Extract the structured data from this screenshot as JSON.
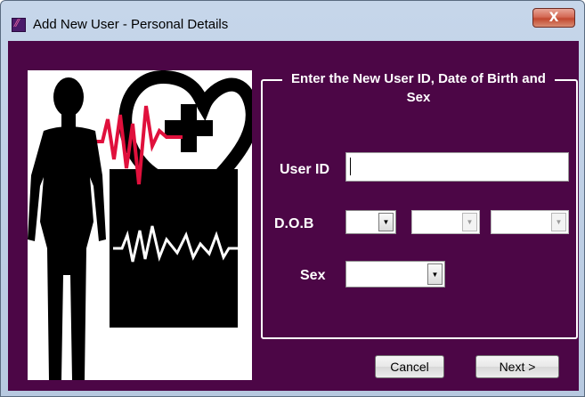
{
  "window": {
    "title": "Add New User - Personal Details",
    "close_label": "X"
  },
  "form": {
    "group_title": "Enter the New User ID, Date of Birth and Sex",
    "user_id_label": "User ID",
    "user_id_value": "",
    "dob_label": "D.O.B",
    "dob_day": "",
    "dob_month": "",
    "dob_year": "",
    "sex_label": "Sex",
    "sex_value": ""
  },
  "buttons": {
    "cancel": "Cancel",
    "next": "Next >"
  },
  "colors": {
    "panel_background": "#4c0646",
    "ecg_line": "#e0103c"
  },
  "icons": {
    "app": "app-logo-icon",
    "illustration": "health-heart-ecg-illustration"
  }
}
